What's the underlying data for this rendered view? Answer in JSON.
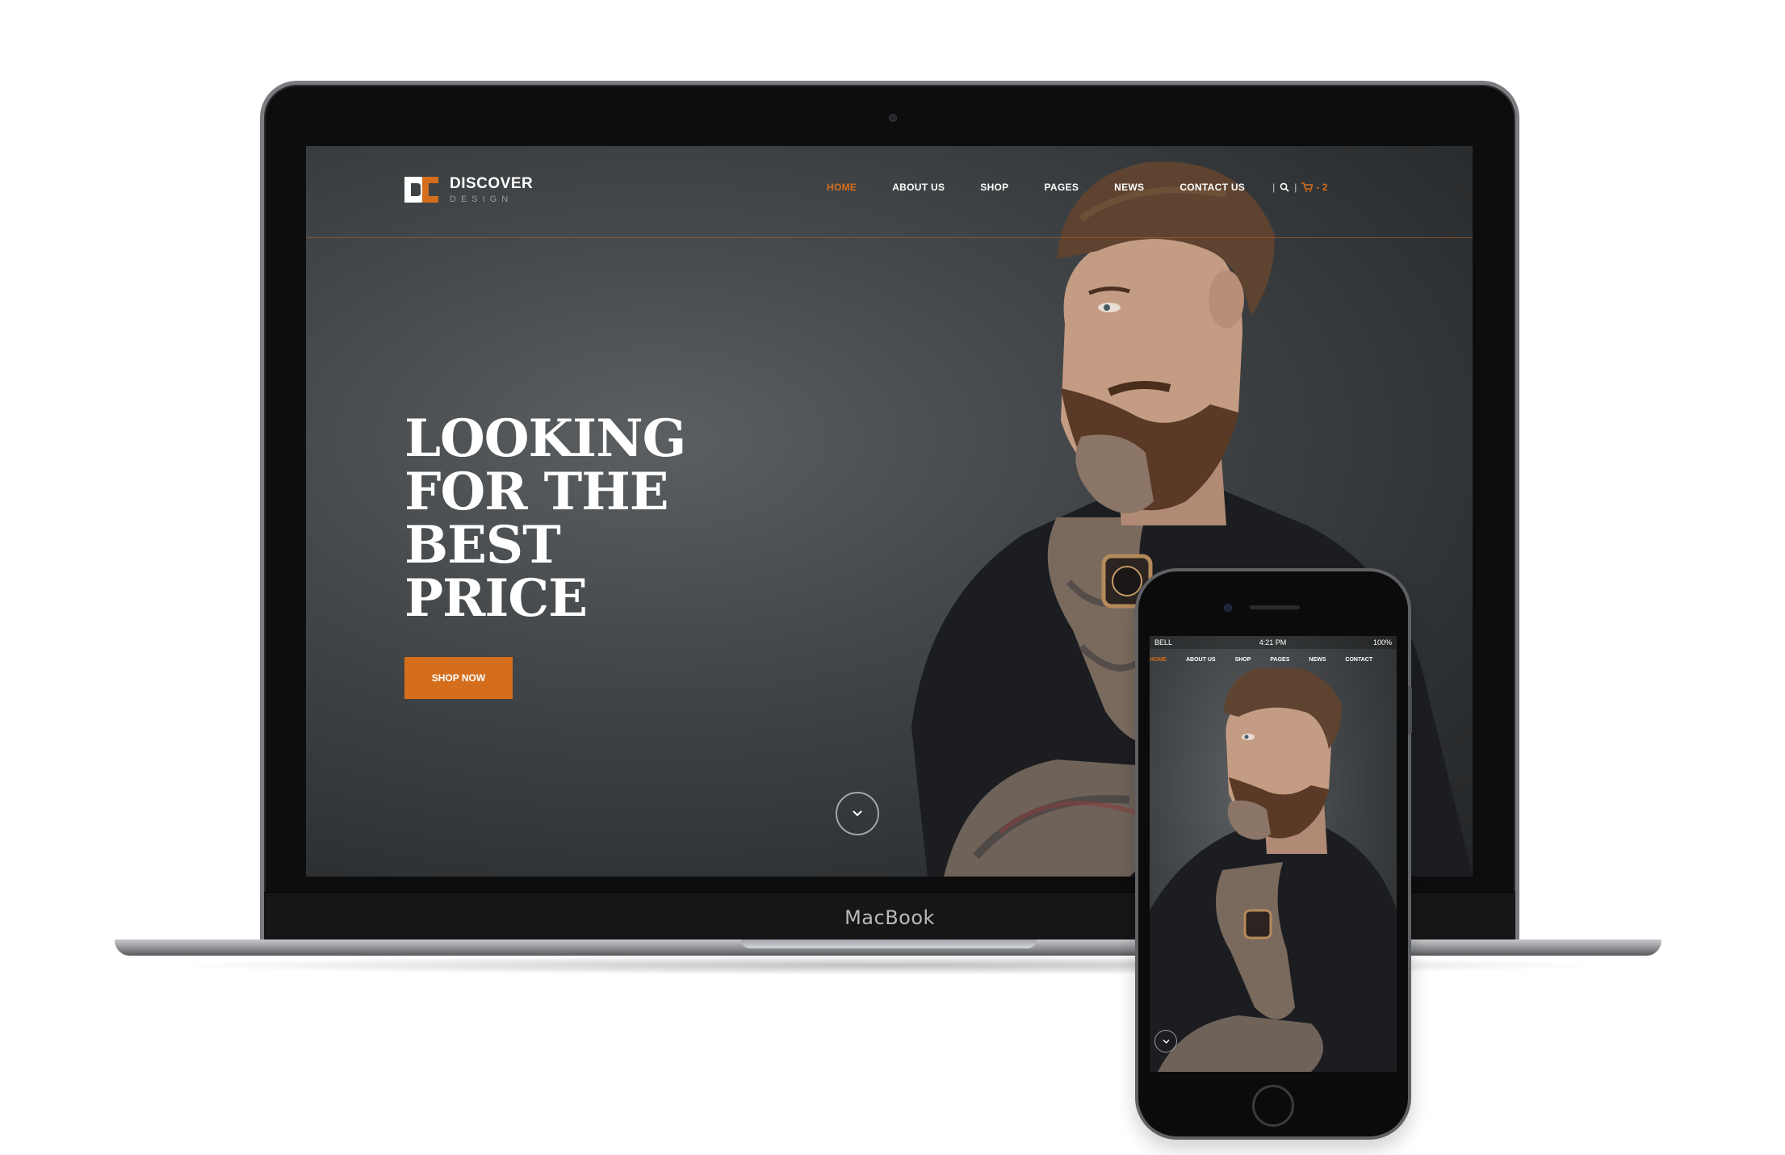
{
  "laptop": {
    "brand_label": "MacBook"
  },
  "site": {
    "logo": {
      "name": "DISCOVER",
      "tagline": "DESIGN",
      "icon": "discover-logo-mark"
    },
    "nav": {
      "items": [
        {
          "label": "HOME",
          "active": true
        },
        {
          "label": "ABOUT US",
          "active": false
        },
        {
          "label": "SHOP",
          "active": false
        },
        {
          "label": "PAGES",
          "active": false
        },
        {
          "label": "NEWS",
          "active": false
        },
        {
          "label": "CONTACT US",
          "active": false
        }
      ],
      "separator": "|",
      "search_icon": "search-icon",
      "cart_icon": "cart-icon",
      "cart_count": "- 2"
    },
    "hero": {
      "headline_lines": [
        "LOOKING",
        "FOR THE",
        "BEST",
        "PRICE"
      ],
      "cta_label": "SHOP NOW",
      "scroll_icon": "chevron-down-icon"
    }
  },
  "phone": {
    "status": {
      "carrier": "BELL",
      "time": "4:21 PM",
      "battery": "100%"
    },
    "nav": [
      "HOME",
      "ABOUT US",
      "SHOP",
      "PAGES",
      "NEWS",
      "CONTACT"
    ]
  },
  "colors": {
    "accent": "#d56e1c",
    "hero_background": "#3f4345",
    "text_light": "#ffffff"
  }
}
